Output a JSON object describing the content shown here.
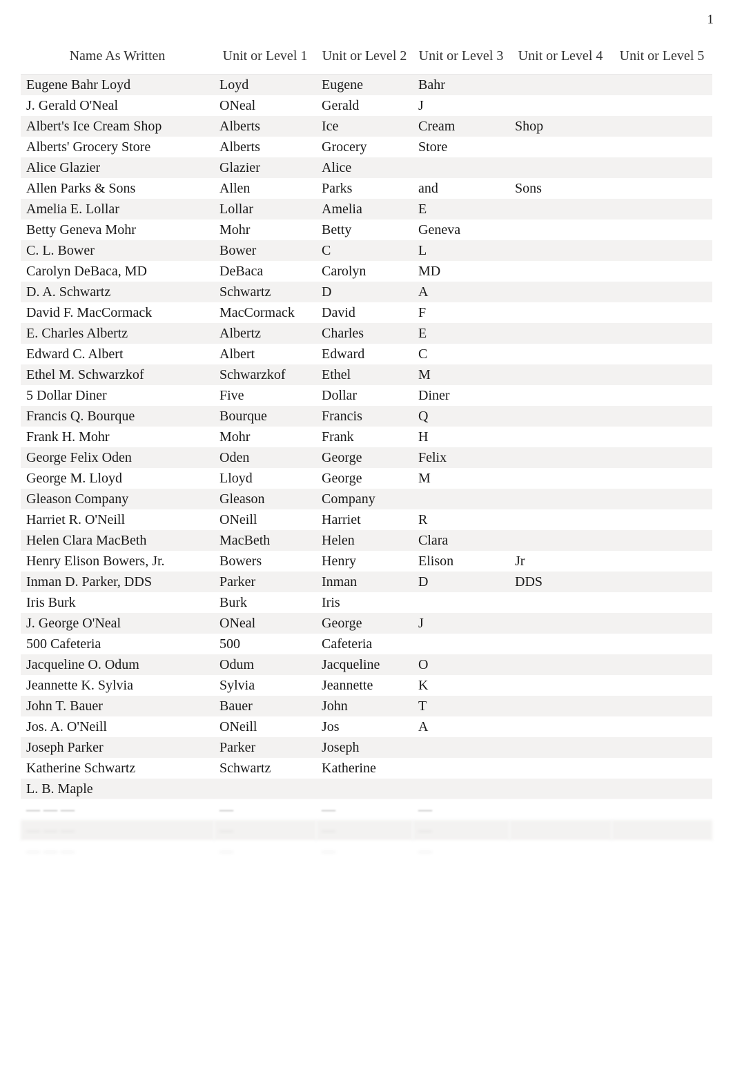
{
  "page_number": "1",
  "table": {
    "headers": [
      "Name As Written",
      "Unit or Level 1",
      "Unit or Level 2",
      "Unit or Level 3",
      "Unit or Level 4",
      "Unit or Level 5"
    ],
    "rows": [
      {
        "name": "Eugene Bahr Loyd",
        "u1": "Loyd",
        "u2": "Eugene",
        "u3": "Bahr",
        "u4": "",
        "u5": ""
      },
      {
        "name": "J. Gerald O'Neal",
        "u1": "ONeal",
        "u2": "Gerald",
        "u3": "J",
        "u4": "",
        "u5": ""
      },
      {
        "name": "Albert's Ice Cream Shop",
        "u1": "Alberts",
        "u2": "Ice",
        "u3": "Cream",
        "u4": "Shop",
        "u5": ""
      },
      {
        "name": "Alberts' Grocery Store",
        "u1": "Alberts",
        "u2": "Grocery",
        "u3": "Store",
        "u4": "",
        "u5": ""
      },
      {
        "name": "Alice Glazier",
        "u1": "Glazier",
        "u2": "Alice",
        "u3": "",
        "u4": "",
        "u5": ""
      },
      {
        "name": "Allen Parks & Sons",
        "u1": "Allen",
        "u2": "Parks",
        "u3": "and",
        "u4": "Sons",
        "u5": ""
      },
      {
        "name": "Amelia E. Lollar",
        "u1": "Lollar",
        "u2": "Amelia",
        "u3": "E",
        "u4": "",
        "u5": ""
      },
      {
        "name": "Betty Geneva Mohr",
        "u1": "Mohr",
        "u2": "Betty",
        "u3": "Geneva",
        "u4": "",
        "u5": ""
      },
      {
        "name": "C. L. Bower",
        "u1": "Bower",
        "u2": "C",
        "u3": "L",
        "u4": "",
        "u5": ""
      },
      {
        "name": "Carolyn DeBaca, MD",
        "u1": "DeBaca",
        "u2": "Carolyn",
        "u3": "MD",
        "u4": "",
        "u5": ""
      },
      {
        "name": "D. A. Schwartz",
        "u1": "Schwartz",
        "u2": "D",
        "u3": "A",
        "u4": "",
        "u5": ""
      },
      {
        "name": "David F. MacCormack",
        "u1": "MacCormack",
        "u2": "David",
        "u3": "F",
        "u4": "",
        "u5": ""
      },
      {
        "name": "E. Charles Albertz",
        "u1": "Albertz",
        "u2": "Charles",
        "u3": "E",
        "u4": "",
        "u5": ""
      },
      {
        "name": "Edward C. Albert",
        "u1": "Albert",
        "u2": "Edward",
        "u3": "C",
        "u4": "",
        "u5": ""
      },
      {
        "name": "Ethel M. Schwarzkof",
        "u1": "Schwarzkof",
        "u2": "Ethel",
        "u3": "M",
        "u4": "",
        "u5": ""
      },
      {
        "name": "5 Dollar Diner",
        "u1": "Five",
        "u2": "Dollar",
        "u3": "Diner",
        "u4": "",
        "u5": ""
      },
      {
        "name": "Francis Q. Bourque",
        "u1": "Bourque",
        "u2": "Francis",
        "u3": "Q",
        "u4": "",
        "u5": ""
      },
      {
        "name": "Frank H. Mohr",
        "u1": "Mohr",
        "u2": "Frank",
        "u3": "H",
        "u4": "",
        "u5": ""
      },
      {
        "name": "George Felix Oden",
        "u1": "Oden",
        "u2": "George",
        "u3": "Felix",
        "u4": "",
        "u5": ""
      },
      {
        "name": "George M. Lloyd",
        "u1": "Lloyd",
        "u2": "George",
        "u3": "M",
        "u4": "",
        "u5": ""
      },
      {
        "name": "Gleason Company",
        "u1": "Gleason",
        "u2": "Company",
        "u3": "",
        "u4": "",
        "u5": ""
      },
      {
        "name": "Harriet R. O'Neill",
        "u1": "ONeill",
        "u2": "Harriet",
        "u3": "R",
        "u4": "",
        "u5": ""
      },
      {
        "name": "Helen Clara MacBeth",
        "u1": "MacBeth",
        "u2": "Helen",
        "u3": "Clara",
        "u4": "",
        "u5": ""
      },
      {
        "name": "Henry Elison Bowers, Jr.",
        "u1": "Bowers",
        "u2": "Henry",
        "u3": "Elison",
        "u4": "Jr",
        "u5": ""
      },
      {
        "name": "Inman D. Parker, DDS",
        "u1": "Parker",
        "u2": "Inman",
        "u3": "D",
        "u4": "DDS",
        "u5": ""
      },
      {
        "name": "Iris Burk",
        "u1": "Burk",
        "u2": "Iris",
        "u3": "",
        "u4": "",
        "u5": ""
      },
      {
        "name": "J. George O'Neal",
        "u1": "ONeal",
        "u2": "George",
        "u3": "J",
        "u4": "",
        "u5": ""
      },
      {
        "name": "500 Cafeteria",
        "u1": "500",
        "u2": "Cafeteria",
        "u3": "",
        "u4": "",
        "u5": ""
      },
      {
        "name": "Jacqueline O. Odum",
        "u1": "Odum",
        "u2": "Jacqueline",
        "u3": "O",
        "u4": "",
        "u5": ""
      },
      {
        "name": "Jeannette K. Sylvia",
        "u1": "Sylvia",
        "u2": "Jeannette",
        "u3": "K",
        "u4": "",
        "u5": ""
      },
      {
        "name": "John T. Bauer",
        "u1": "Bauer",
        "u2": "John",
        "u3": "T",
        "u4": "",
        "u5": ""
      },
      {
        "name": "Jos. A. O'Neill",
        "u1": "ONeill",
        "u2": "Jos",
        "u3": "A",
        "u4": "",
        "u5": ""
      },
      {
        "name": "Joseph Parker",
        "u1": "Parker",
        "u2": "Joseph",
        "u3": "",
        "u4": "",
        "u5": ""
      },
      {
        "name": "Katherine Schwartz",
        "u1": "Schwartz",
        "u2": "Katherine",
        "u3": "",
        "u4": "",
        "u5": ""
      },
      {
        "name": "L. B. Maple",
        "u1": "",
        "u2": "",
        "u3": "",
        "u4": "",
        "u5": ""
      }
    ],
    "blurred_rows": [
      {
        "name": "— — —",
        "u1": "—",
        "u2": "—",
        "u3": "—",
        "u4": "",
        "u5": ""
      },
      {
        "name": "— — —",
        "u1": "—",
        "u2": "—",
        "u3": "—",
        "u4": "",
        "u5": ""
      },
      {
        "name": "— — —",
        "u1": "—",
        "u2": "—",
        "u3": "—",
        "u4": "",
        "u5": ""
      }
    ]
  }
}
